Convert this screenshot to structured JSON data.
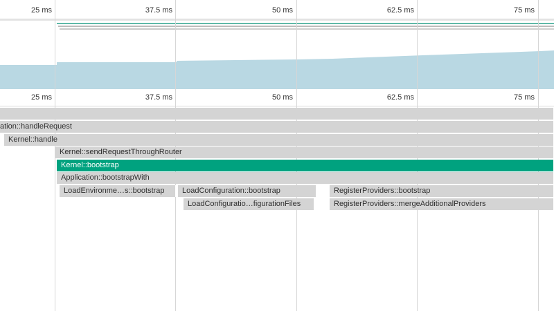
{
  "ruler": {
    "ticks": [
      "25 ms",
      "37.5 ms",
      "50 ms",
      "62.5 ms",
      "75 ms"
    ]
  },
  "colors": {
    "selected": "#00a27f",
    "bar": "#d4d4d4",
    "overview_fill": "#b9d8e3",
    "gridline": "#d6d6d6"
  },
  "flame": {
    "root_label": "",
    "handle_request": "ation::handleRequest",
    "kernel_handle": "Kernel::handle",
    "send_request": "Kernel::sendRequestThroughRouter",
    "kernel_bootstrap": "Kernel::bootstrap",
    "bootstrap_with": "Application::bootstrapWith",
    "load_env": "LoadEnvironme…s::bootstrap",
    "load_config": "LoadConfiguration::bootstrap",
    "load_config_files": "LoadConfiguratio…figurationFiles",
    "register_providers": "RegisterProviders::bootstrap",
    "merge_providers": "RegisterProviders::mergeAdditionalProviders"
  }
}
